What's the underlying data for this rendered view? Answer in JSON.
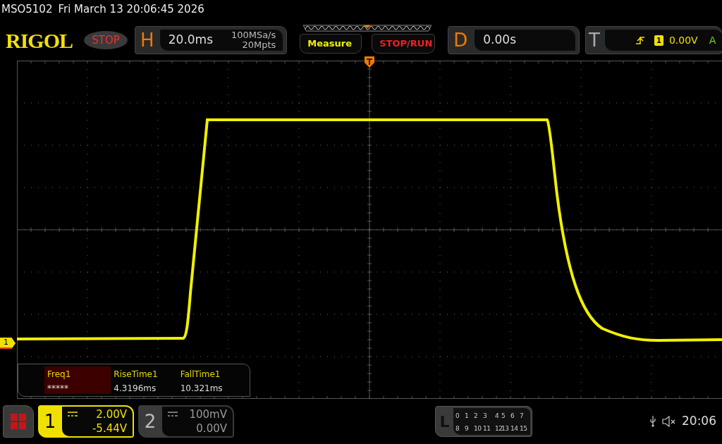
{
  "status_line": {
    "model": "MSO5102",
    "datetime": "Fri March 13 20:06:45 2026"
  },
  "header": {
    "logo": "RIGOL",
    "run_state": "STOP",
    "horizontal": {
      "label": "H",
      "scale": "20.0ms",
      "sample_rate": "100MSa/s",
      "memory_depth": "20Mpts"
    },
    "buttons": [
      {
        "label": "Measure",
        "kind": "measure"
      },
      {
        "label": "STOP/RUN",
        "kind": "run"
      }
    ],
    "delay": {
      "label": "D",
      "value": "0.00s"
    },
    "trigger": {
      "label": "T",
      "source": "1",
      "level": "0.00V",
      "mode": "A"
    }
  },
  "channel_marker": "1",
  "measurements": [
    {
      "name": "Freq1",
      "value": "*****",
      "selected": true
    },
    {
      "name": "RiseTime1",
      "value": "4.3196ms",
      "selected": false
    },
    {
      "name": "FallTime1",
      "value": "10.321ms",
      "selected": false
    }
  ],
  "channels": [
    {
      "number": "1",
      "scale": "2.00V",
      "offset": "-5.44V",
      "selected": true
    },
    {
      "number": "2",
      "scale": "100mV",
      "offset": "0.00V",
      "selected": false
    }
  ],
  "logic": {
    "label": "L",
    "rows": [
      [
        "0",
        "1",
        "2",
        "3",
        "4",
        "5",
        "6",
        "7"
      ],
      [
        "8",
        "9",
        "10",
        "11",
        "12",
        "13",
        "14",
        "15"
      ]
    ]
  },
  "clock": "20:06"
}
